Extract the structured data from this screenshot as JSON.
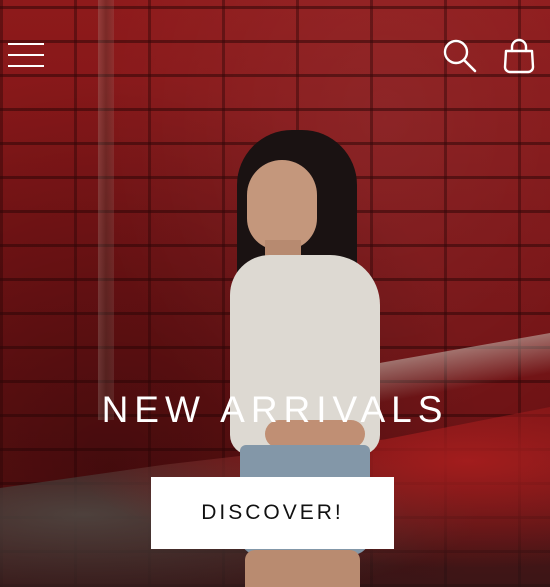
{
  "header": {
    "menu_icon": "hamburger-menu-icon",
    "search_icon": "search-icon",
    "cart_icon": "shopping-bag-icon"
  },
  "hero": {
    "headline": "NEW ARRIVALS",
    "cta_label": "DISCOVER!"
  },
  "colors": {
    "text": "#ffffff",
    "button_bg": "#ffffff",
    "button_text": "#111111",
    "wall": "#7a1416"
  }
}
